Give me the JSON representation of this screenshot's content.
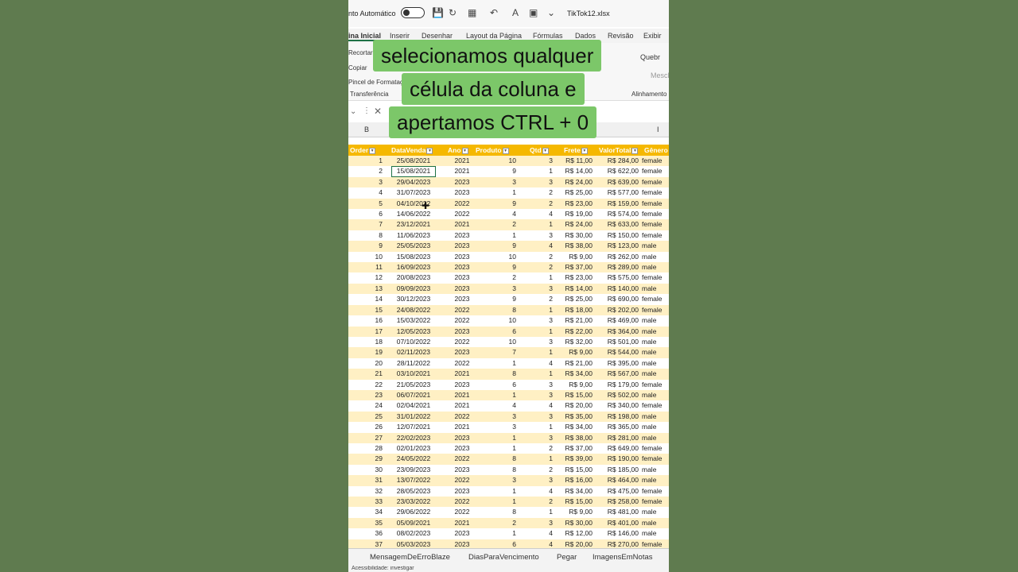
{
  "titlebar": {
    "autosave_label": "nto Automático",
    "filename": "TikTok12.xlsx"
  },
  "ribbon_tabs": [
    "ina Inicial",
    "Inserir",
    "Desenhar",
    "Layout da Página",
    "Fórmulas",
    "Dados",
    "Revisão",
    "Exibir"
  ],
  "ribbon": {
    "cut": "Recortar",
    "copy": "Copiar",
    "format_painter": "Pincel de Formatação",
    "clipboard_group": "Transferência",
    "wrap": "Quebr",
    "merge": "Mescl",
    "alignment_group": "Alinhamento"
  },
  "columns": {
    "first": "B",
    "last": "I"
  },
  "caption_lines": [
    "selecionamos qualquer",
    "célula da coluna e",
    "apertamos CTRL + 0"
  ],
  "table": {
    "headers": [
      "Order",
      "DataVenda",
      "Ano",
      "Produto",
      "Qtd",
      "Frete",
      "ValorTotal",
      "Gênero"
    ],
    "rows": [
      [
        "1",
        "25/08/2021",
        "2021",
        "10",
        "3",
        "R$ 11,00",
        "R$ 284,00",
        "female"
      ],
      [
        "2",
        "15/08/2021",
        "2021",
        "9",
        "1",
        "R$ 14,00",
        "R$ 622,00",
        "female"
      ],
      [
        "3",
        "29/04/2023",
        "2023",
        "3",
        "3",
        "R$ 24,00",
        "R$ 639,00",
        "female"
      ],
      [
        "4",
        "31/07/2023",
        "2023",
        "1",
        "2",
        "R$ 25,00",
        "R$ 577,00",
        "female"
      ],
      [
        "5",
        "04/10/2022",
        "2022",
        "9",
        "2",
        "R$ 23,00",
        "R$ 159,00",
        "female"
      ],
      [
        "6",
        "14/06/2022",
        "2022",
        "4",
        "4",
        "R$ 19,00",
        "R$ 574,00",
        "female"
      ],
      [
        "7",
        "23/12/2021",
        "2021",
        "2",
        "1",
        "R$ 24,00",
        "R$ 633,00",
        "female"
      ],
      [
        "8",
        "11/06/2023",
        "2023",
        "1",
        "3",
        "R$ 30,00",
        "R$ 150,00",
        "female"
      ],
      [
        "9",
        "25/05/2023",
        "2023",
        "9",
        "4",
        "R$ 38,00",
        "R$ 123,00",
        "male"
      ],
      [
        "10",
        "15/08/2023",
        "2023",
        "10",
        "2",
        "R$ 9,00",
        "R$ 262,00",
        "male"
      ],
      [
        "11",
        "16/09/2023",
        "2023",
        "9",
        "2",
        "R$ 37,00",
        "R$ 289,00",
        "male"
      ],
      [
        "12",
        "20/08/2023",
        "2023",
        "2",
        "1",
        "R$ 23,00",
        "R$ 575,00",
        "female"
      ],
      [
        "13",
        "09/09/2023",
        "2023",
        "3",
        "3",
        "R$ 14,00",
        "R$ 140,00",
        "male"
      ],
      [
        "14",
        "30/12/2023",
        "2023",
        "9",
        "2",
        "R$ 25,00",
        "R$ 690,00",
        "female"
      ],
      [
        "15",
        "24/08/2022",
        "2022",
        "8",
        "1",
        "R$ 18,00",
        "R$ 202,00",
        "female"
      ],
      [
        "16",
        "15/03/2022",
        "2022",
        "10",
        "3",
        "R$ 21,00",
        "R$ 469,00",
        "male"
      ],
      [
        "17",
        "12/05/2023",
        "2023",
        "6",
        "1",
        "R$ 22,00",
        "R$ 364,00",
        "male"
      ],
      [
        "18",
        "07/10/2022",
        "2022",
        "10",
        "3",
        "R$ 32,00",
        "R$ 501,00",
        "male"
      ],
      [
        "19",
        "02/11/2023",
        "2023",
        "7",
        "1",
        "R$ 9,00",
        "R$ 544,00",
        "male"
      ],
      [
        "20",
        "28/11/2022",
        "2022",
        "1",
        "4",
        "R$ 21,00",
        "R$ 395,00",
        "male"
      ],
      [
        "21",
        "03/10/2021",
        "2021",
        "8",
        "1",
        "R$ 34,00",
        "R$ 567,00",
        "male"
      ],
      [
        "22",
        "21/05/2023",
        "2023",
        "6",
        "3",
        "R$ 9,00",
        "R$ 179,00",
        "female"
      ],
      [
        "23",
        "06/07/2021",
        "2021",
        "1",
        "3",
        "R$ 15,00",
        "R$ 502,00",
        "male"
      ],
      [
        "24",
        "02/04/2021",
        "2021",
        "4",
        "4",
        "R$ 20,00",
        "R$ 340,00",
        "female"
      ],
      [
        "25",
        "31/01/2022",
        "2022",
        "3",
        "3",
        "R$ 35,00",
        "R$ 198,00",
        "male"
      ],
      [
        "26",
        "12/07/2021",
        "2021",
        "3",
        "1",
        "R$ 34,00",
        "R$ 365,00",
        "male"
      ],
      [
        "27",
        "22/02/2023",
        "2023",
        "1",
        "3",
        "R$ 38,00",
        "R$ 281,00",
        "male"
      ],
      [
        "28",
        "02/01/2023",
        "2023",
        "1",
        "2",
        "R$ 37,00",
        "R$ 649,00",
        "female"
      ],
      [
        "29",
        "24/05/2022",
        "2022",
        "8",
        "1",
        "R$ 39,00",
        "R$ 190,00",
        "female"
      ],
      [
        "30",
        "23/09/2023",
        "2023",
        "8",
        "2",
        "R$ 15,00",
        "R$ 185,00",
        "male"
      ],
      [
        "31",
        "13/07/2022",
        "2022",
        "3",
        "3",
        "R$ 16,00",
        "R$ 464,00",
        "male"
      ],
      [
        "32",
        "28/05/2023",
        "2023",
        "1",
        "4",
        "R$ 34,00",
        "R$ 475,00",
        "female"
      ],
      [
        "33",
        "23/03/2022",
        "2022",
        "1",
        "2",
        "R$ 15,00",
        "R$ 258,00",
        "female"
      ],
      [
        "34",
        "29/06/2022",
        "2022",
        "8",
        "1",
        "R$ 9,00",
        "R$ 481,00",
        "male"
      ],
      [
        "35",
        "05/09/2021",
        "2021",
        "2",
        "3",
        "R$ 30,00",
        "R$ 401,00",
        "male"
      ],
      [
        "36",
        "08/02/2023",
        "2023",
        "1",
        "4",
        "R$ 12,00",
        "R$ 146,00",
        "male"
      ],
      [
        "37",
        "05/03/2023",
        "2023",
        "6",
        "4",
        "R$ 20,00",
        "R$ 270,00",
        "female"
      ]
    ]
  },
  "sheet_tabs": [
    "MensagemDeErroBlaze",
    "DiasParaVencimento",
    "Pegar",
    "ImagensEmNotas"
  ],
  "status": "Acessibilidade: investigar"
}
